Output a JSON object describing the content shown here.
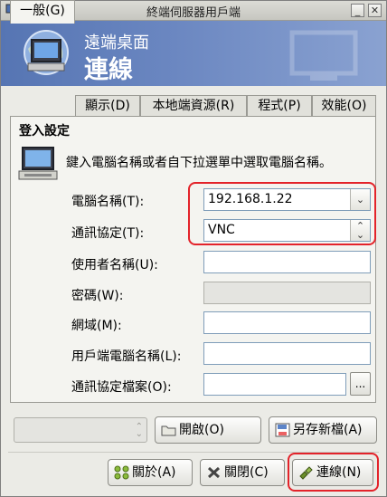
{
  "window": {
    "title": "終端伺服器用戶端"
  },
  "banner": {
    "subtitle": "遠端桌面",
    "title": "連線"
  },
  "tabs": [
    {
      "label": "一般(G)"
    },
    {
      "label": "顯示(D)"
    },
    {
      "label": "本地端資源(R)"
    },
    {
      "label": "程式(P)"
    },
    {
      "label": "效能(O)"
    }
  ],
  "login": {
    "section_title": "登入設定",
    "instruction": "鍵入電腦名稱或者自下拉選單中選取電腦名稱。"
  },
  "form": {
    "computer_label": "電腦名稱(T):",
    "computer_value": "192.168.1.22",
    "protocol_label": "通訊協定(T):",
    "protocol_value": "VNC",
    "username_label": "使用者名稱(U):",
    "username_value": "",
    "password_label": "密碼(W):",
    "domain_label": "網域(M):",
    "domain_value": "",
    "client_label": "用戶端電腦名稱(L):",
    "client_value": "",
    "protocol_file_label": "通訊協定檔案(O):",
    "protocol_file_value": "",
    "browse_label": "..."
  },
  "actions": {
    "open_label": "開啟(O)",
    "save_as_label": "另存新檔(A)",
    "about_label": "關於(A)",
    "close_label": "關閉(C)",
    "connect_label": "連線(N)"
  },
  "colors": {
    "highlight": "#e3232a",
    "banner": "#6b87c1"
  }
}
